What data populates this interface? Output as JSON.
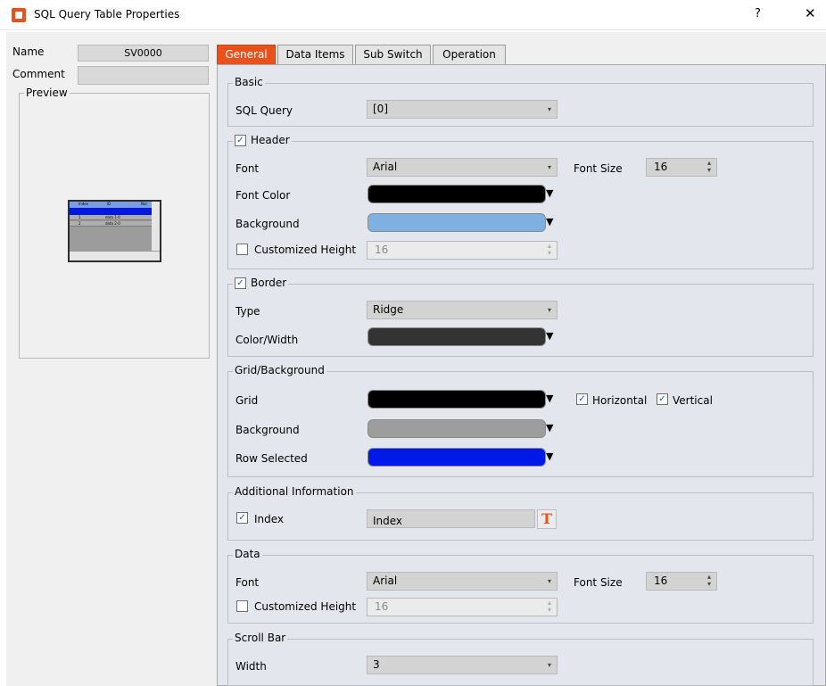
{
  "window": {
    "title": "SQL Query Table Properties",
    "help": "?",
    "close": "✕"
  },
  "left": {
    "name_label": "Name",
    "name_value": "SV0000",
    "comment_label": "Comment",
    "preview_label": "Preview",
    "thumb": {
      "col1": "Index",
      "col2": "ID",
      "col3": "Nar",
      "row1_index": "1",
      "row1_data": "data 1-0",
      "row2_index": "2",
      "row2_data": "data 2-0"
    }
  },
  "tabs": [
    "General",
    "Data Items",
    "Sub Switch",
    "Operation"
  ],
  "basic": {
    "legend": "Basic",
    "sql_query_label": "SQL Query",
    "sql_query_value": "[0]"
  },
  "header": {
    "legend": "Header",
    "font_label": "Font",
    "font_value": "Arial",
    "font_size_label": "Font Size",
    "font_size_value": "16",
    "font_color_label": "Font Color",
    "font_color": "#000000",
    "background_label": "Background",
    "background_color": "#7fb0e2",
    "custom_height_label": "Customized Height",
    "custom_height_value": "16"
  },
  "border": {
    "legend": "Border",
    "type_label": "Type",
    "type_value": "Ridge",
    "color_width_label": "Color/Width",
    "color": "#333333"
  },
  "grid": {
    "legend": "Grid/Background",
    "grid_label": "Grid",
    "grid_color": "#000000",
    "horizontal_label": "Horizontal",
    "vertical_label": "Vertical",
    "background_label": "Background",
    "background_color": "#9d9d9d",
    "row_selected_label": "Row Selected",
    "row_selected_color": "#0019e8"
  },
  "additional": {
    "legend": "Additional Information",
    "index_label": "Index",
    "index_value": "Index",
    "text_button": "T"
  },
  "data": {
    "legend": "Data",
    "font_label": "Font",
    "font_value": "Arial",
    "font_size_label": "Font Size",
    "font_size_value": "16",
    "custom_height_label": "Customized Height",
    "custom_height_value": "16"
  },
  "scroll_bar": {
    "legend": "Scroll Bar",
    "width_label": "Width",
    "width_value": "3"
  },
  "glyphs": {
    "check": "✓",
    "dropdown": "▼",
    "tri_down": "▾",
    "spin": "▴\n▾"
  }
}
